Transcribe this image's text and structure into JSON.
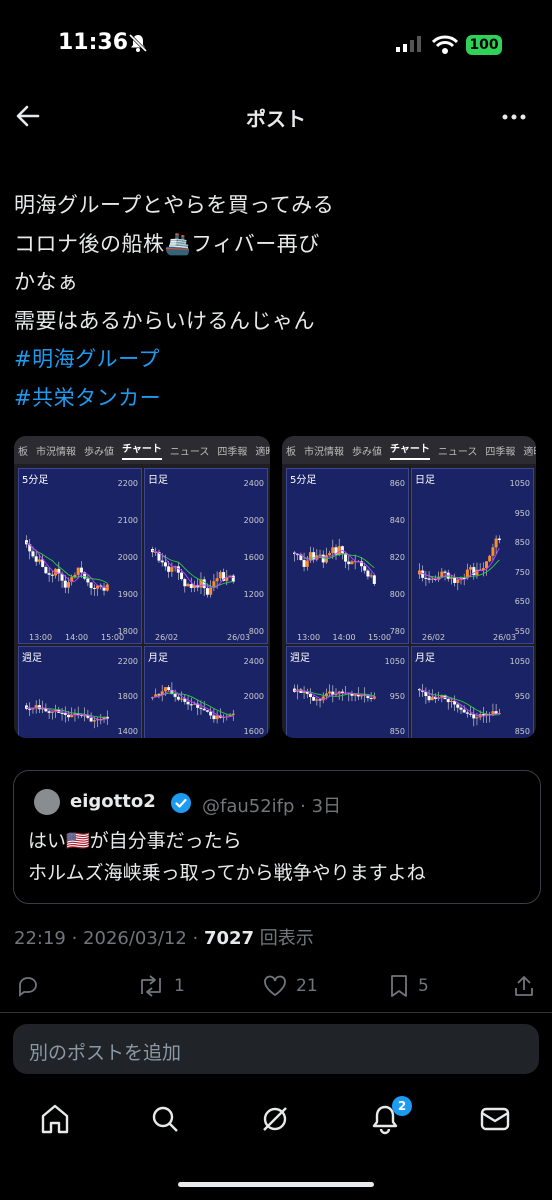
{
  "status": {
    "time": "11:36",
    "battery": "100"
  },
  "header": {
    "title": "ポスト"
  },
  "post": {
    "lines": [
      "明海グループとやらを買ってみる",
      "コロナ後の船株🚢フィバー再び",
      "かなぁ",
      "需要はあるからいけるんじゃん"
    ],
    "hashtags": [
      "#明海グループ",
      "#共栄タンカー"
    ]
  },
  "charts": {
    "left": {
      "tabs": [
        "板",
        "市況情報",
        "歩み値",
        "チャート",
        "ニュース",
        "四季報",
        "適時"
      ],
      "active_tab": "チャート",
      "panels": [
        {
          "label": "5分足",
          "yticks": [
            "2200",
            "2100",
            "2000",
            "1900",
            "1800"
          ],
          "xticks": [
            "13:00",
            "14:00",
            "15:00"
          ]
        },
        {
          "label": "日足",
          "yticks": [
            "2400",
            "2000",
            "1600",
            "1200",
            "800"
          ],
          "xticks": [
            "26/02",
            "26/03"
          ]
        },
        {
          "label": "週足",
          "yticks": [
            "2200",
            "1800",
            "1400"
          ],
          "xticks": []
        },
        {
          "label": "月足",
          "yticks": [
            "2400",
            "2000",
            "1600"
          ],
          "xticks": []
        }
      ]
    },
    "right": {
      "tabs": [
        "板",
        "市況情報",
        "歩み値",
        "チャート",
        "ニュース",
        "四季報",
        "適時"
      ],
      "active_tab": "チャート",
      "panels": [
        {
          "label": "5分足",
          "yticks": [
            "860",
            "840",
            "820",
            "800",
            "780"
          ],
          "xticks": [
            "13:00",
            "14:00",
            "15:00"
          ]
        },
        {
          "label": "日足",
          "yticks": [
            "1050",
            "950",
            "850",
            "750",
            "650",
            "550"
          ],
          "xticks": [
            "26/02",
            "26/03"
          ]
        },
        {
          "label": "週足",
          "yticks": [
            "1050",
            "950",
            "850"
          ],
          "xticks": []
        },
        {
          "label": "月足",
          "yticks": [
            "1050",
            "950",
            "850"
          ],
          "xticks": []
        }
      ]
    }
  },
  "quote": {
    "name": "eigotto2",
    "handle": "@fau52ifp · 3日",
    "lines": [
      "はい🇺🇸が自分事だったら",
      "ホルムズ海峡乗っ取ってから戦争やりますよね"
    ]
  },
  "meta": {
    "time": "22:19 · 2026/03/12 · ",
    "views": "7027",
    "views_label": " 回表示"
  },
  "actions": {
    "reposts": "1",
    "likes": "21",
    "bookmarks": "5"
  },
  "composer": {
    "placeholder": "別のポストを追加"
  },
  "nav": {
    "notifications_badge": "2"
  },
  "colors": {
    "accent": "#1d9bf0",
    "panel": "#1a2366",
    "verified": "#1d9bf0"
  }
}
